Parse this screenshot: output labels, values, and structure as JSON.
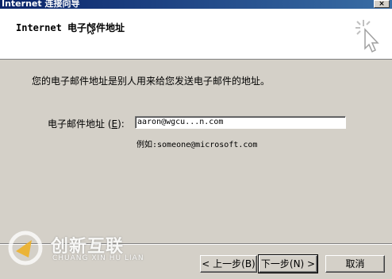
{
  "window": {
    "title": "Internet 连接向导",
    "close_glyph": "×"
  },
  "header": {
    "heading": "Internet 电子邮件地址"
  },
  "body": {
    "intro": "您的电子邮件地址是别人用来给您发送电子邮件的地址。",
    "email_label_prefix": "电子邮件地址 (",
    "email_label_key": "E",
    "email_label_suffix": "):",
    "email_value": "aaron@wgcu...n.com",
    "example": "例如:someone@microsoft.com"
  },
  "buttons": {
    "back": "< 上一步(B)",
    "next": "下一步(N) >",
    "cancel": "取消"
  },
  "watermark": {
    "brand": "创新互联",
    "sub": "CHUANG XIN HU LIAN"
  }
}
